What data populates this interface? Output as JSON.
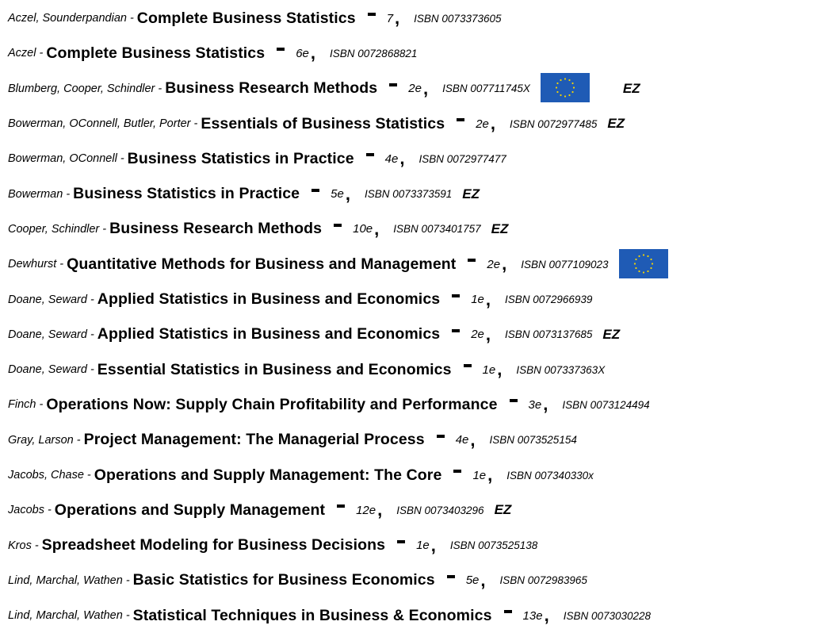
{
  "flag_color": "#1f5bb5",
  "star_color": "#f5d400",
  "icons": {
    "flag": "eu-flag-icon"
  },
  "books": [
    {
      "authors": "Aczel, Sounderpandian",
      "sep": "-",
      "title": "Complete Business Statistics",
      "edition": "7",
      "isbn": "ISBN 0073373605",
      "eu_flag": false,
      "ez": ""
    },
    {
      "authors": "Aczel",
      "sep": "-",
      "title": "Complete Business Statistics",
      "edition": "6e",
      "isbn": "ISBN 0072868821",
      "eu_flag": false,
      "ez": ""
    },
    {
      "authors": "Blumberg, Cooper, Schindler",
      "sep": "-",
      "title": "Business Research Methods",
      "edition": "2e",
      "isbn": "ISBN 007711745X",
      "eu_flag": true,
      "ez": "EZ"
    },
    {
      "authors": "Bowerman, OConnell, Butler, Porter",
      "sep": "-",
      "title": "Essentials of Business Statistics",
      "edition": "2e",
      "isbn": "ISBN 0072977485",
      "eu_flag": false,
      "ez": "EZ"
    },
    {
      "authors": "Bowerman, OConnell",
      "sep": "-",
      "title": "Business Statistics in Practice",
      "edition": "4e",
      "isbn": "ISBN 0072977477",
      "eu_flag": false,
      "ez": ""
    },
    {
      "authors": "Bowerman",
      "sep": "-",
      "title": "Business Statistics in Practice",
      "edition": "5e",
      "isbn": "ISBN 0073373591",
      "eu_flag": false,
      "ez": "EZ"
    },
    {
      "authors": "Cooper, Schindler",
      "sep": "-",
      "title": "Business Research Methods",
      "edition": "10e",
      "isbn": "ISBN 0073401757",
      "eu_flag": false,
      "ez": "EZ"
    },
    {
      "authors": "Dewhurst",
      "sep": "-",
      "title": "Quantitative Methods for Business and Management",
      "edition": "2e",
      "isbn": "ISBN 0077109023",
      "eu_flag": true,
      "ez": ""
    },
    {
      "authors": "Doane, Seward",
      "sep": "-",
      "title": "Applied Statistics in Business and Economics",
      "edition": "1e",
      "isbn": "ISBN 0072966939",
      "eu_flag": false,
      "ez": ""
    },
    {
      "authors": "Doane, Seward",
      "sep": "-",
      "title": "Applied Statistics in Business and Economics",
      "edition": "2e",
      "isbn": "ISBN 0073137685",
      "eu_flag": false,
      "ez": "EZ"
    },
    {
      "authors": "Doane, Seward",
      "sep": "-",
      "title": "Essential Statistics in Business and Economics",
      "edition": "1e",
      "isbn": "ISBN 007337363X",
      "eu_flag": false,
      "ez": ""
    },
    {
      "authors": "Finch",
      "sep": "-",
      "title": "Operations Now: Supply Chain Profitability and Performance",
      "edition": "3e",
      "isbn": "ISBN 0073124494",
      "eu_flag": false,
      "ez": ""
    },
    {
      "authors": "Gray, Larson",
      "sep": "-",
      "title": "Project Management: The Managerial Process",
      "edition": "4e",
      "isbn": "ISBN 0073525154",
      "eu_flag": false,
      "ez": ""
    },
    {
      "authors": "Jacobs, Chase",
      "sep": "-",
      "title": "Operations and Supply Management: The Core",
      "edition": "1e",
      "isbn": "ISBN 007340330x",
      "eu_flag": false,
      "ez": ""
    },
    {
      "authors": "Jacobs",
      "sep": "-",
      "title": "Operations and Supply Management",
      "edition": "12e",
      "isbn": "ISBN 0073403296",
      "eu_flag": false,
      "ez": "EZ"
    },
    {
      "authors": "Kros",
      "sep": "-",
      "title": "Spreadsheet Modeling for Business Decisions",
      "edition": "1e",
      "isbn": "ISBN 0073525138",
      "eu_flag": false,
      "ez": ""
    },
    {
      "authors": "Lind, Marchal, Wathen",
      "sep": "-",
      "title": "Basic Statistics for Business Economics",
      "edition": "5e",
      "isbn": "ISBN 0072983965",
      "eu_flag": false,
      "ez": ""
    },
    {
      "authors": "Lind, Marchal, Wathen",
      "sep": "-",
      "title": "Statistical Techniques in Business & Economics",
      "edition": "13e",
      "isbn": "ISBN 0073030228",
      "eu_flag": false,
      "ez": ""
    }
  ]
}
